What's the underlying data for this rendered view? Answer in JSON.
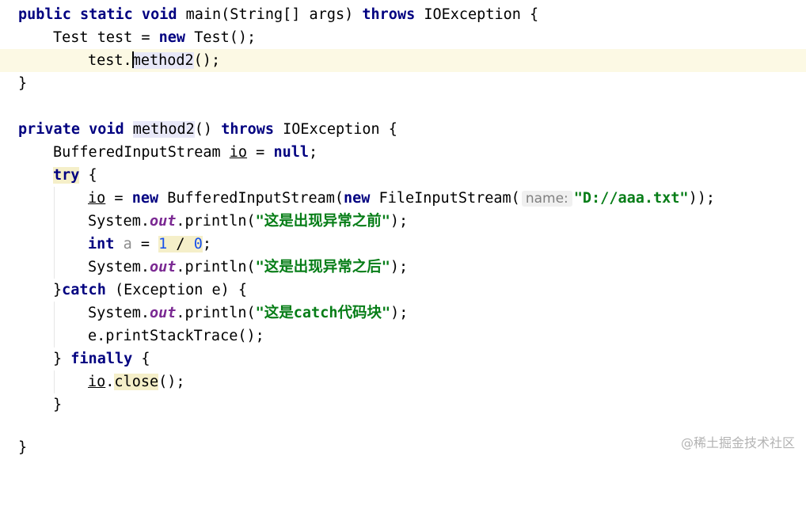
{
  "code": {
    "line1": {
      "kw1": "public static void",
      "t1": " main(String[] args) ",
      "kw2": "throws",
      "t2": " IOException {"
    },
    "line2": {
      "t1": "Test test = ",
      "kw1": "new",
      "t2": " Test();"
    },
    "line3": {
      "t1": "test.",
      "method": "method2",
      "t2": "();"
    },
    "line4": {
      "t1": "}"
    },
    "line6": {
      "kw1": "private void",
      "t1": " ",
      "method": "method2",
      "t2": "() ",
      "kw2": "throws",
      "t3": " IOException {"
    },
    "line7": {
      "t1": "BufferedInputStream ",
      "var": "io",
      "t2": " = ",
      "kw1": "null",
      "t3": ";"
    },
    "line8": {
      "kw1": "try",
      "t1": " {"
    },
    "line9": {
      "var": "io",
      "t1": " = ",
      "kw1": "new",
      "t2": " BufferedInputStream(",
      "kw2": "new",
      "t3": " FileInputStream(",
      "hint": "name:",
      "str": "\"D://aaa.txt\"",
      "t4": "));"
    },
    "line10": {
      "t1": "System.",
      "fld": "out",
      "t2": ".println(",
      "str": "\"这是出现异常之前\"",
      "t3": ");"
    },
    "line11": {
      "kw1": "int",
      "t1": " ",
      "unused": "a",
      "t2": " = ",
      "n1": "1",
      "t3": " / ",
      "n2": "0",
      "t4": ";"
    },
    "line12": {
      "t1": "System.",
      "fld": "out",
      "t2": ".println(",
      "str": "\"这是出现异常之后\"",
      "t3": ");"
    },
    "line13": {
      "t1": "}",
      "kw1": "catch",
      "t2": " (Exception e) {"
    },
    "line14": {
      "t1": "System.",
      "fld": "out",
      "t2": ".println(",
      "str": "\"这是catch代码块\"",
      "t3": ");"
    },
    "line15": {
      "t1": "e.printStackTrace();"
    },
    "line16": {
      "t1": "} ",
      "kw1": "finally",
      "t2": " {"
    },
    "line17": {
      "var": "io",
      "t1": ".",
      "method": "close",
      "t2": "();"
    },
    "line18": {
      "t1": "}"
    },
    "line20": {
      "t1": "}"
    }
  },
  "watermark": "@稀土掘金技术社区",
  "colors": {
    "keyword": "#000080",
    "string": "#067d17",
    "number": "#1750eb",
    "field": "#7b2a93",
    "current_line": "#fcf9e4"
  }
}
